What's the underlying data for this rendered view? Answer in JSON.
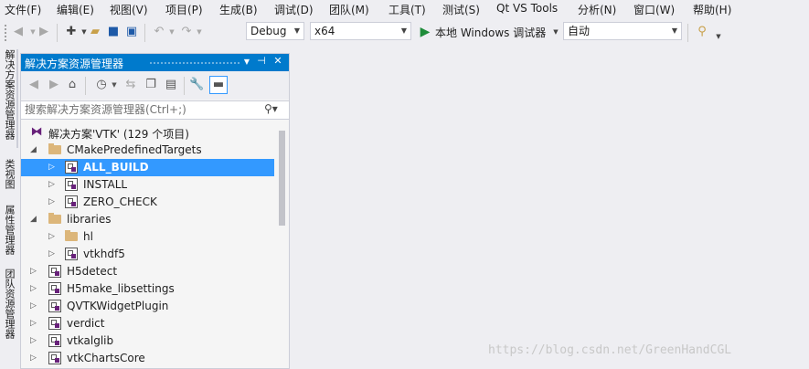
{
  "menu": [
    "文件(F)",
    "编辑(E)",
    "视图(V)",
    "项目(P)",
    "生成(B)",
    "调试(D)",
    "团队(M)",
    "工具(T)",
    "测试(S)",
    "Qt VS Tools",
    "分析(N)",
    "窗口(W)",
    "帮助(H)"
  ],
  "toolbar": {
    "config": "Debug",
    "platform": "x64",
    "run_label": "本地 Windows 调试器",
    "auto": "自动"
  },
  "side_tabs": [
    "解决方案资源管理器",
    "类视图",
    "属性管理器",
    "团队资源管理器"
  ],
  "panel": {
    "title": "解决方案资源管理器",
    "search_placeholder": "搜索解决方案资源管理器(Ctrl+;)"
  },
  "tree": [
    {
      "label": "解决方案'VTK' (129 个项目)",
      "type": "solution",
      "level": 0,
      "expander": ""
    },
    {
      "label": "CMakePredefinedTargets",
      "type": "folder",
      "level": 1,
      "expander": "open"
    },
    {
      "label": "ALL_BUILD",
      "type": "project",
      "level": 2,
      "expander": "closed",
      "selected": true
    },
    {
      "label": "INSTALL",
      "type": "project",
      "level": 2,
      "expander": "closed"
    },
    {
      "label": "ZERO_CHECK",
      "type": "project",
      "level": 2,
      "expander": "closed"
    },
    {
      "label": "libraries",
      "type": "folder",
      "level": 1,
      "expander": "open"
    },
    {
      "label": "hl",
      "type": "folder",
      "level": 2,
      "expander": "closed"
    },
    {
      "label": "vtkhdf5",
      "type": "project",
      "level": 2,
      "expander": "closed"
    },
    {
      "label": "H5detect",
      "type": "project",
      "level": 1,
      "expander": "closed"
    },
    {
      "label": "H5make_libsettings",
      "type": "project",
      "level": 1,
      "expander": "closed"
    },
    {
      "label": "QVTKWidgetPlugin",
      "type": "project",
      "level": 1,
      "expander": "closed"
    },
    {
      "label": "verdict",
      "type": "project",
      "level": 1,
      "expander": "closed"
    },
    {
      "label": "vtkalglib",
      "type": "project",
      "level": 1,
      "expander": "closed"
    },
    {
      "label": "vtkChartsCore",
      "type": "project",
      "level": 1,
      "expander": "closed"
    }
  ],
  "watermark": "https://blog.csdn.net/GreenHandCGL",
  "colors": {
    "accent": "#007acc",
    "selection": "#3399ff",
    "background": "#eeeef2"
  }
}
